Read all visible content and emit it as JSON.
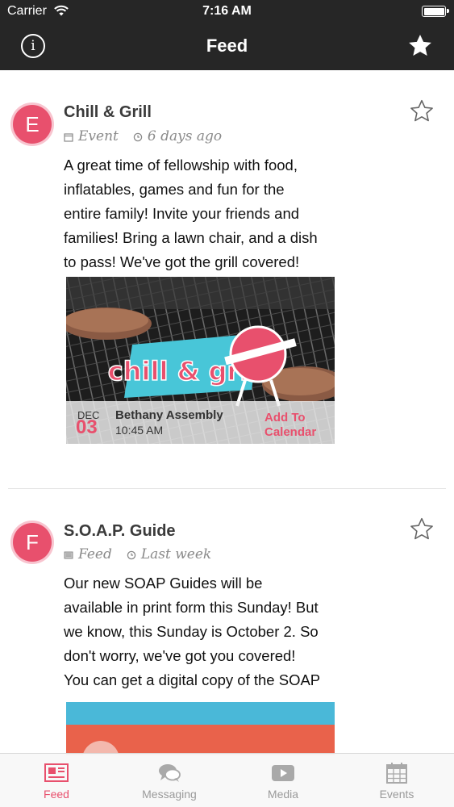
{
  "status_bar": {
    "carrier": "Carrier",
    "time": "7:16 AM"
  },
  "nav": {
    "title": "Feed",
    "info_icon": "info-icon",
    "favorites_icon": "star-icon"
  },
  "posts": [
    {
      "avatar_letter": "E",
      "title": "Chill & Grill",
      "type": "Event",
      "type_icon": "calendar-icon",
      "time": "6 days ago",
      "body": [
        "A great time of fellowship with food,",
        "inflatables, games and fun for the",
        "entire family! Invite your friends and",
        "families! Bring a lawn chair, and a dish",
        "to pass! We've got the grill covered!"
      ],
      "image_logo": "chill & grill",
      "event": {
        "month": "DEC",
        "day": "03",
        "location": "Bethany Assembly",
        "time": "10:45 AM",
        "add_to_calendar": [
          "Add To",
          "Calendar"
        ]
      }
    },
    {
      "avatar_letter": "F",
      "title": "S.O.A.P. Guide",
      "type": "Feed",
      "type_icon": "newspaper-icon",
      "time": "Last week",
      "body": [
        "Our new SOAP Guides will be",
        "available in print form this Sunday! But",
        "we know, this Sunday is October 2. So",
        "don't worry, we've got you covered!",
        "You can get a digital copy of the SOAP"
      ]
    }
  ],
  "tabs": [
    {
      "label": "Feed",
      "icon": "newspaper-icon",
      "active": true
    },
    {
      "label": "Messaging",
      "icon": "chat-bubbles-icon",
      "active": false
    },
    {
      "label": "Media",
      "icon": "play-icon",
      "active": false
    },
    {
      "label": "Events",
      "icon": "calendar-icon",
      "active": false
    }
  ],
  "colors": {
    "accent": "#e8506d",
    "header": "#262626",
    "meta": "#8a8a8a",
    "tab_inactive": "#9a9a9a"
  }
}
